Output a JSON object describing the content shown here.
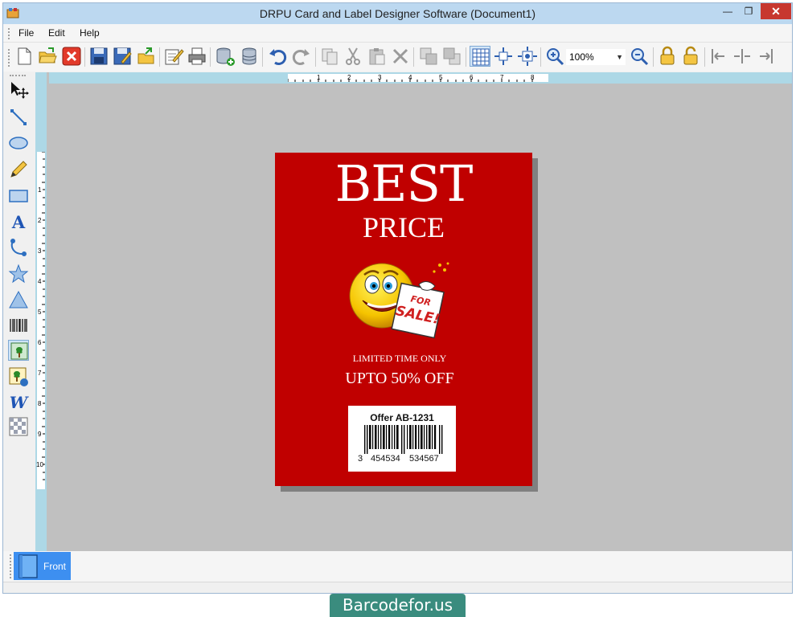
{
  "window": {
    "title": "DRPU Card and Label Designer Software  (Document1)",
    "minimize_glyph": "—",
    "maximize_glyph": "❐",
    "close_glyph": "✕"
  },
  "menu": {
    "items": [
      {
        "label": "File",
        "accel": "F"
      },
      {
        "label": "Edit",
        "accel": "E"
      },
      {
        "label": "Help",
        "accel": "H"
      }
    ]
  },
  "toolbar": {
    "zoom_value": "100%",
    "icons": [
      "new-document-icon",
      "open-folder-icon",
      "close-document-icon",
      "save-icon",
      "save-as-icon",
      "export-icon",
      "properties-icon",
      "print-icon",
      "database-add-icon",
      "database-icon",
      "undo-icon",
      "redo-icon",
      "copy-icon",
      "cut-icon",
      "paste-icon",
      "delete-icon",
      "bring-front-icon",
      "send-back-icon",
      "grid-icon",
      "fit-icon",
      "center-icon",
      "zoom-in-icon",
      "zoom-out-icon",
      "lock-icon",
      "unlock-icon",
      "align-left-icon",
      "align-center-icon",
      "align-right-icon"
    ]
  },
  "tools": {
    "icons": [
      "select-move-icon",
      "line-icon",
      "ellipse-icon",
      "pencil-icon",
      "rectangle-icon",
      "text-icon",
      "arc-icon",
      "star-icon",
      "triangle-icon",
      "barcode-icon",
      "picture-icon",
      "image-library-icon",
      "word-art-icon",
      "watermark-icon"
    ]
  },
  "rulers": {
    "top_labels": [
      "1",
      "2",
      "3",
      "4",
      "5",
      "6",
      "7",
      "8"
    ],
    "left_labels": [
      "1",
      "2",
      "3",
      "4",
      "5",
      "6",
      "7",
      "8",
      "9",
      "10"
    ]
  },
  "card": {
    "headline": "BEST",
    "subheadline": "PRICE",
    "sale_sign_line1": "FOR",
    "sale_sign_line2": "SALE!",
    "tagline": "LIMITED TIME ONLY",
    "offer": "UPTO 50% OFF",
    "barcode_title": "Offer AB-1231",
    "barcode_digit_first": "3",
    "barcode_digits_left": "454534",
    "barcode_digits_right": "534567",
    "background_color": "#c00000"
  },
  "tabs": {
    "front_label": "Front"
  },
  "watermark": {
    "text": "Barcodefor.us"
  }
}
